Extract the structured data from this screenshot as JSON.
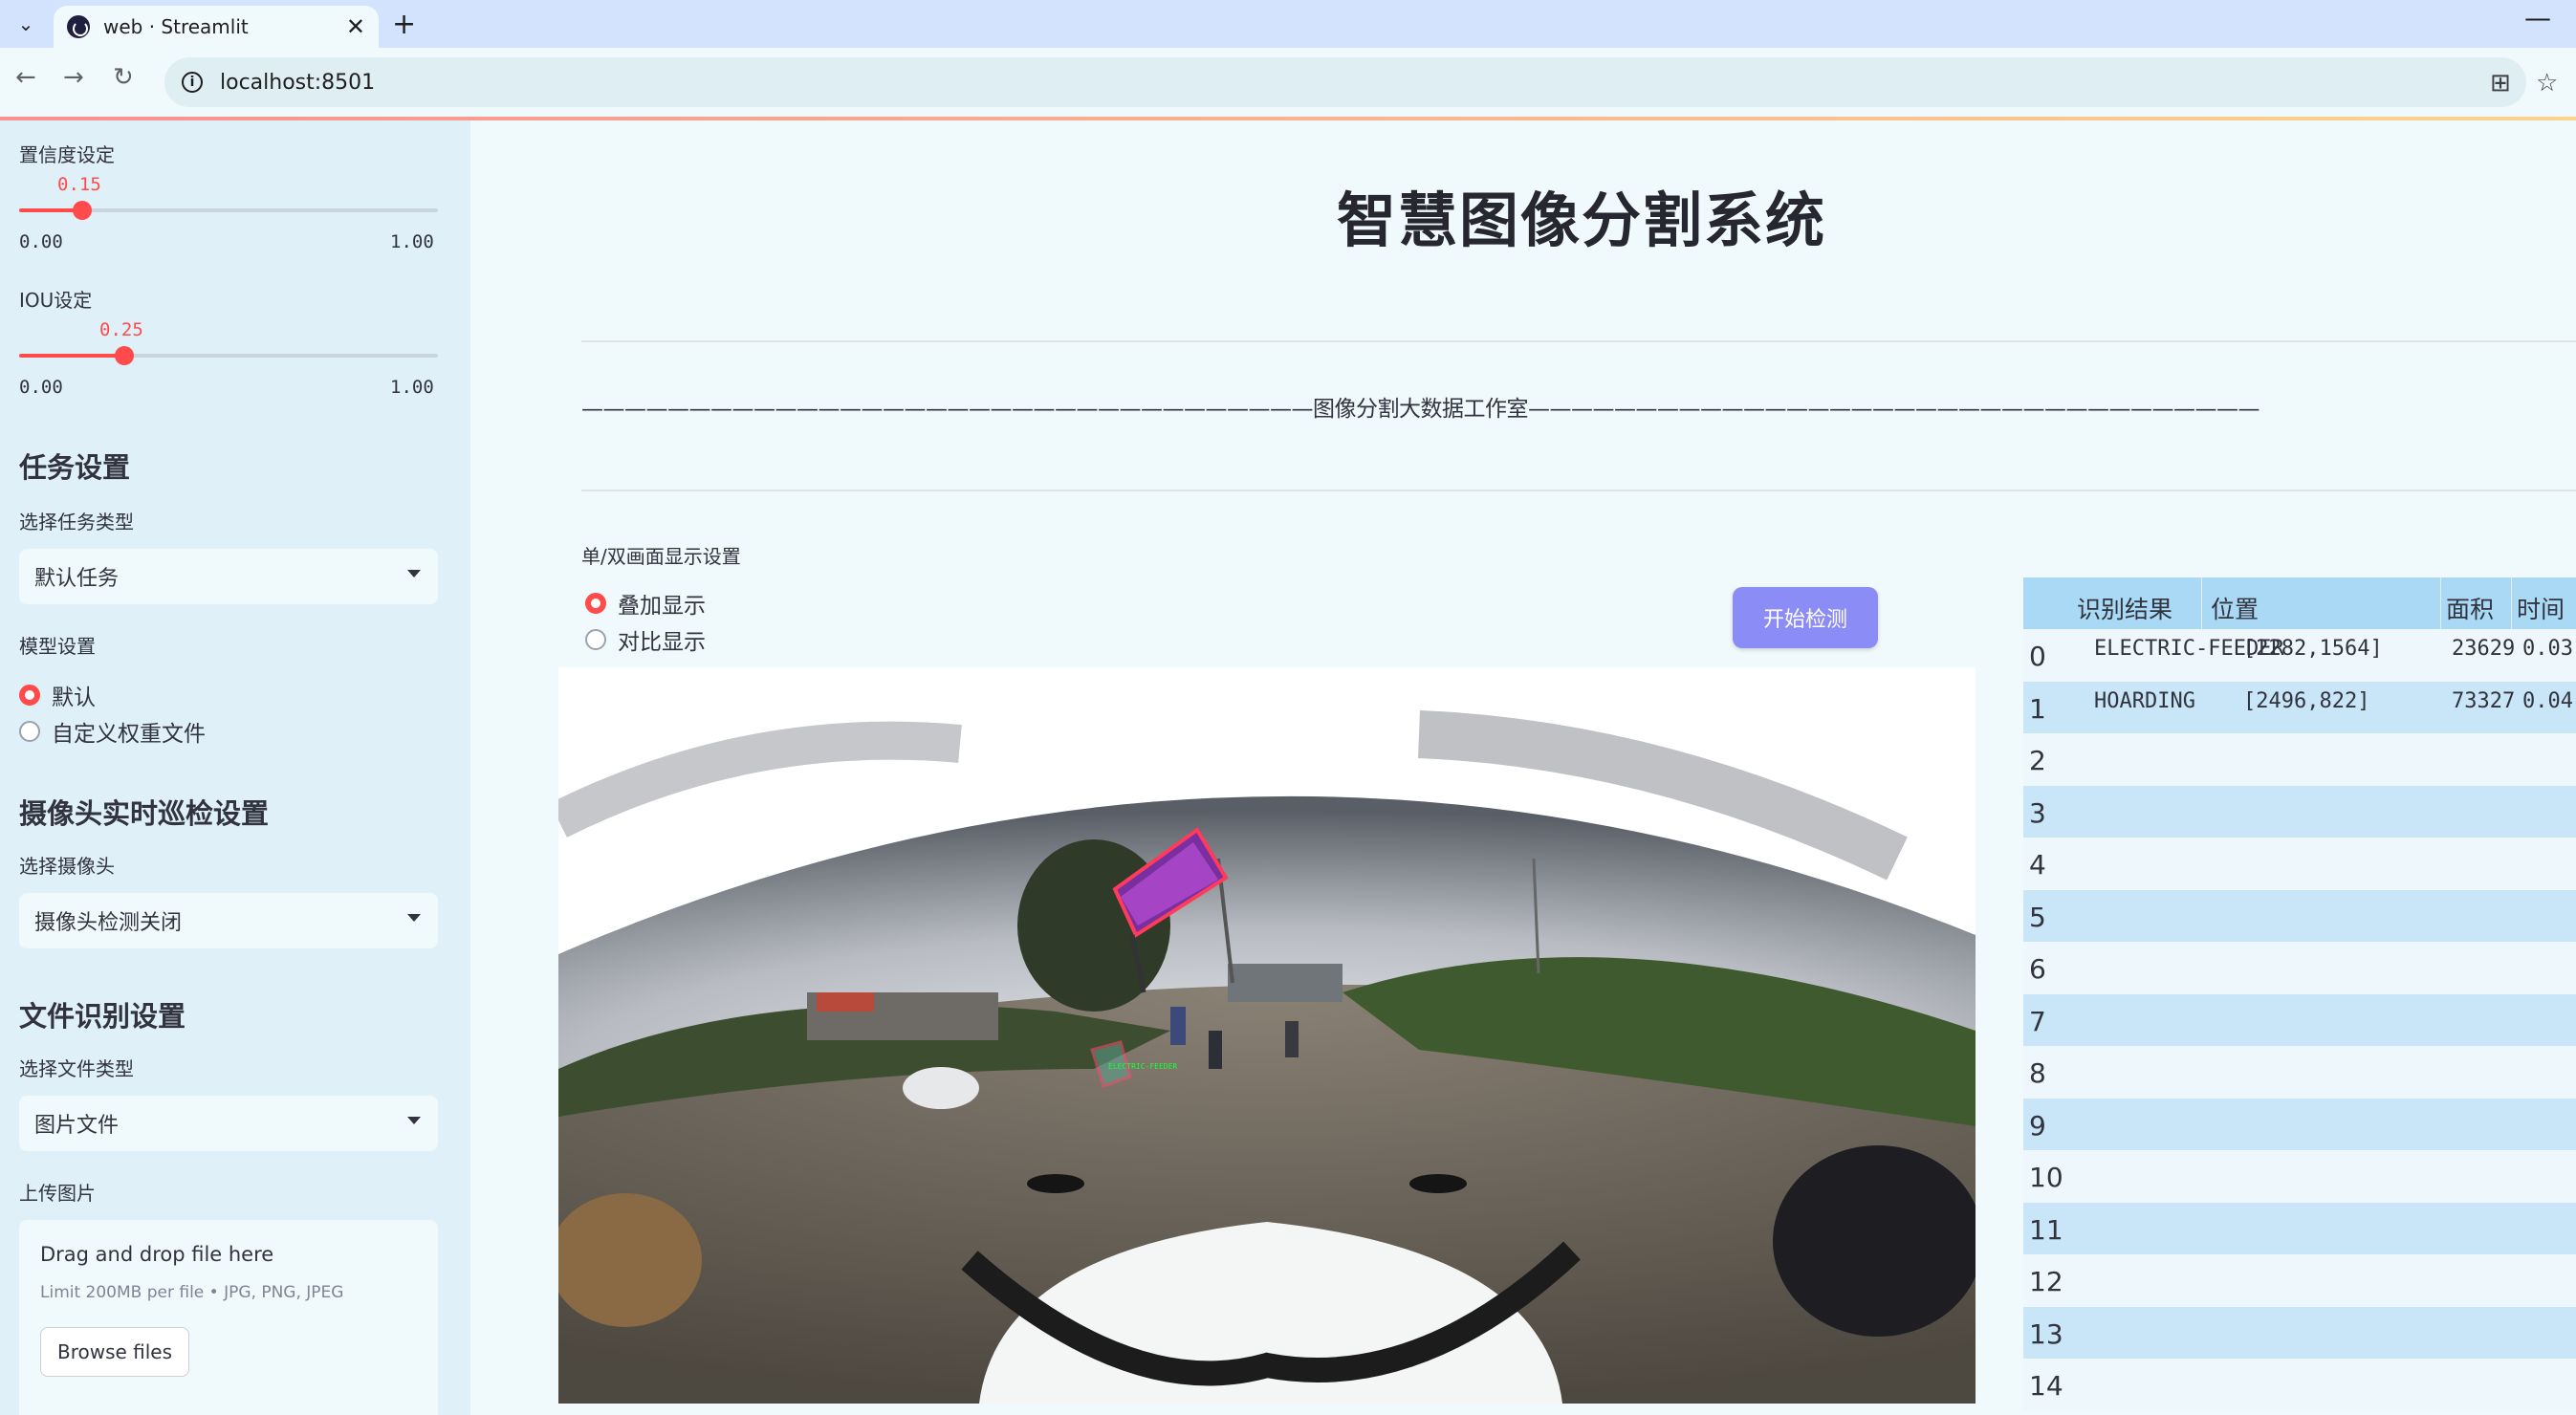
{
  "browser": {
    "tab_title": "web · Streamlit",
    "url": "localhost:8501"
  },
  "sidebar": {
    "confidence": {
      "label": "置信度设定",
      "value": "0.15",
      "value_num": 0.15,
      "min": "0.00",
      "max": "1.00"
    },
    "iou": {
      "label": "IOU设定",
      "value": "0.25",
      "value_num": 0.25,
      "min": "0.00",
      "max": "1.00"
    },
    "task_heading": "任务设置",
    "task_type_label": "选择任务类型",
    "task_type_value": "默认任务",
    "model_label": "模型设置",
    "model_options": [
      "默认",
      "自定义权重文件"
    ],
    "model_selected": "默认",
    "camera_heading": "摄像头实时巡检设置",
    "camera_label": "选择摄像头",
    "camera_value": "摄像头检测关闭",
    "file_heading": "文件识别设置",
    "file_type_label": "选择文件类型",
    "file_type_value": "图片文件",
    "upload_label": "上传图片",
    "upload_title": "Drag and drop file here",
    "upload_limit": "Limit 200MB per file • JPG, PNG, JPEG",
    "browse_label": "Browse files"
  },
  "main": {
    "title": "智慧图像分割系统",
    "banner": "——————————————————————————————————图像分割大数据工作室——————————————————————————————————",
    "display_label": "单/双画面显示设置",
    "display_options": [
      "叠加显示",
      "对比显示"
    ],
    "display_selected": "叠加显示",
    "start_button": "开始检测",
    "overlay_labels": [
      "ELECTRIC-FEEDER"
    ]
  },
  "results_table": {
    "columns": [
      "识别结果",
      "位置",
      "面积",
      "时间"
    ],
    "rows": [
      {
        "index": "0",
        "result": "ELECTRIC-FEEDER",
        "position": "[2282,1564]",
        "area": "23629",
        "time": "0.03"
      },
      {
        "index": "1",
        "result": "HOARDING",
        "position": "[2496,822]",
        "area": "73327",
        "time": "0.04"
      },
      {
        "index": "2"
      },
      {
        "index": "3"
      },
      {
        "index": "4"
      },
      {
        "index": "5"
      },
      {
        "index": "6"
      },
      {
        "index": "7"
      },
      {
        "index": "8"
      },
      {
        "index": "9"
      },
      {
        "index": "10"
      },
      {
        "index": "11"
      },
      {
        "index": "12"
      },
      {
        "index": "13"
      },
      {
        "index": "14"
      }
    ]
  },
  "colors": {
    "accent": "#ff4b4b",
    "button": "#8c8cf7",
    "sidebar_bg": "#dff0f8",
    "table_header": "#a9d9f4"
  }
}
